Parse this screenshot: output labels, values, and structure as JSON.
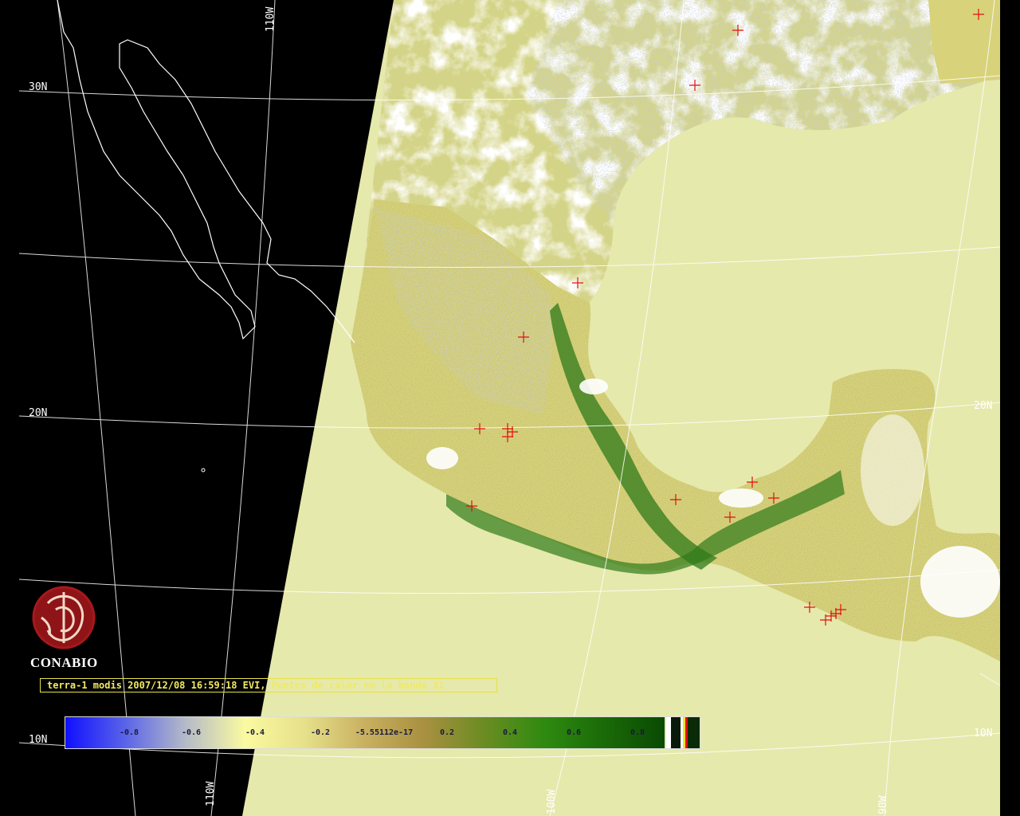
{
  "map": {
    "lat_labels": [
      {
        "text": "30N"
      },
      {
        "text": "20N"
      },
      {
        "text": "20N"
      },
      {
        "text": "10N"
      },
      {
        "text": "10N"
      }
    ],
    "lon_labels": [
      {
        "text": "110W"
      },
      {
        "text": "110W"
      },
      {
        "text": "100W"
      },
      {
        "text": "90W"
      }
    ],
    "colors": {
      "background": "#000000",
      "swath_ocean": "#e6e9ac",
      "cloud": "#ffffff",
      "vegetation_dark": "#2f7a1a",
      "vegetation_mid": "#9a8c3a",
      "vegetation_light": "#d8d27a",
      "marker": "#e01010",
      "graticule": "#ffffff",
      "coast": "#ffffff"
    }
  },
  "logo": {
    "name": "CONABIO",
    "icon": "conabio-logo-icon",
    "color": "#a8181c"
  },
  "caption": {
    "text": "terra-1 modis 2007/12/08 16:59:18 EVI, Puntos de calor en la banda 31"
  },
  "colorbar": {
    "ticks": [
      "-0.8",
      "-0.6",
      "-0.4",
      "-0.2",
      "-5.55112e-17",
      "0.2",
      "0.4",
      "0.6",
      "0.8"
    ],
    "range": [
      -1,
      1
    ]
  }
}
